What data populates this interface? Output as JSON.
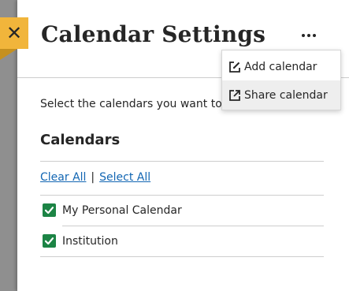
{
  "dialog": {
    "title": "Calendar Settings",
    "close_icon": "close-icon",
    "more_icon": "more-options-icon"
  },
  "content": {
    "intro": "Select the calendars you want to display",
    "section_title": "Calendars",
    "clear_all": "Clear All",
    "separator": "|",
    "select_all": "Select All",
    "calendars": [
      {
        "label": "My Personal Calendar",
        "checked": true
      },
      {
        "label": "Institution",
        "checked": true
      }
    ]
  },
  "menu": {
    "items": [
      {
        "label": "Add calendar",
        "icon": "edit-square-icon"
      },
      {
        "label": "Share calendar",
        "icon": "external-share-icon",
        "hovered": true
      }
    ]
  },
  "colors": {
    "close_accent": "#f1b53b",
    "link": "#1266b3",
    "checkbox": "#1c8445"
  }
}
